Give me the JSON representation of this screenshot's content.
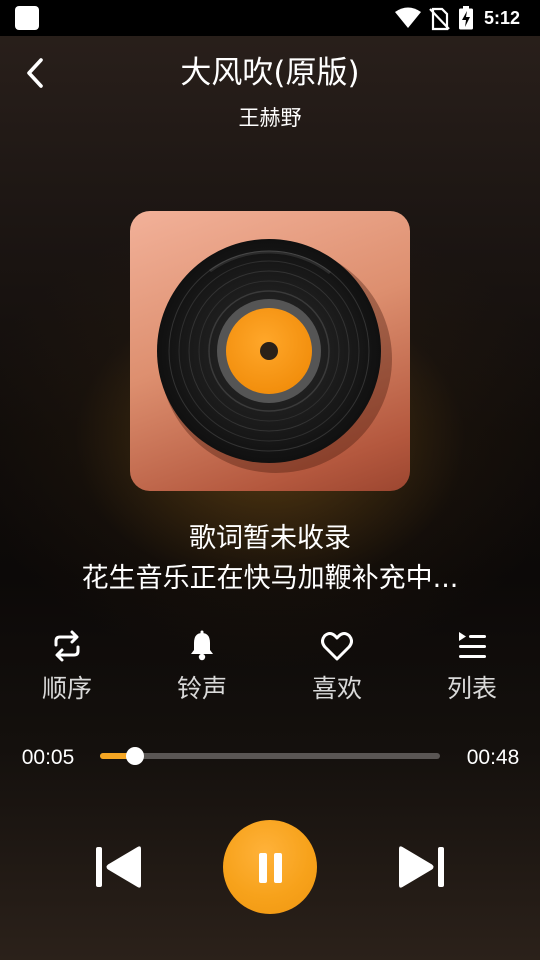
{
  "status_bar": {
    "time": "5:12",
    "icons": [
      "app-square-icon",
      "wifi-icon",
      "no-sim-icon",
      "battery-charging-icon"
    ]
  },
  "header": {
    "title": "大风吹(原版)",
    "artist": "王赫野",
    "back_icon": "chevron-left-icon"
  },
  "album": {
    "art": "vinyl-record-icon",
    "colors": {
      "cover": "#dd8f6f",
      "disc": "#1c1c1c",
      "label": "#f7a21b"
    }
  },
  "lyrics": {
    "line1": "歌词暂未收录",
    "line2": "花生音乐正在快马加鞭补充中..."
  },
  "actions": [
    {
      "label": "顺序",
      "icon": "repeat-icon"
    },
    {
      "label": "铃声",
      "icon": "bell-icon"
    },
    {
      "label": "喜欢",
      "icon": "heart-icon"
    },
    {
      "label": "列表",
      "icon": "playlist-icon"
    }
  ],
  "progress": {
    "current": "00:05",
    "total": "00:48",
    "fraction": 0.1042,
    "fill_color": "#f5a623",
    "track_color": "#5a5654"
  },
  "controls": {
    "prev_icon": "skip-previous-icon",
    "pause_icon": "pause-icon",
    "next_icon": "skip-next-icon",
    "accent_color": "#f7a21b"
  }
}
